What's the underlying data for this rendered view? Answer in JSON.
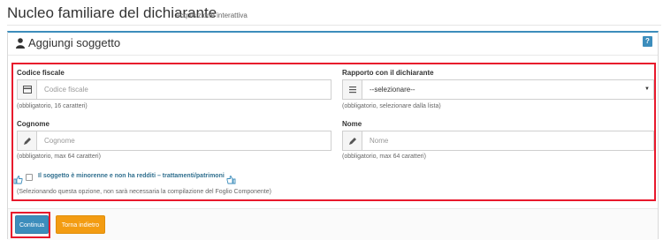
{
  "header": {
    "title": "Nucleo familiare del dichiarante",
    "subtitle": "Acquisizione interattiva"
  },
  "panel": {
    "title": "Aggiungi soggetto",
    "help_label": "?"
  },
  "form": {
    "codice_fiscale": {
      "label": "Codice fiscale",
      "placeholder": "Codice fiscale",
      "hint": "(obbligatorio, 16 caratteri)"
    },
    "rapporto": {
      "label": "Rapporto con il dichiarante",
      "selected": "--selezionare--",
      "hint": "(obbligatorio, selezionare dalla lista)"
    },
    "cognome": {
      "label": "Cognome",
      "placeholder": "Cognome",
      "hint": "(obbligatorio, max 64 caratteri)"
    },
    "nome": {
      "label": "Nome",
      "placeholder": "Nome",
      "hint": "(obbligatorio, max 64 caratteri)"
    },
    "minorenne": {
      "label": "Il soggetto è minorenne e non ha redditi – trattamenti/patrimoni",
      "checked": false,
      "hint": "(Selezionando questa opzione, non sarà necessaria la compilazione del Foglio Componente)"
    }
  },
  "footer": {
    "continue_label": "Continua",
    "back_label": "Torna indietro"
  },
  "colors": {
    "primary": "#3c8dbc",
    "warning": "#f39c12",
    "highlight": "#e8192c"
  },
  "icons": {
    "panel": "user-icon",
    "codice_fiscale": "id-card-icon",
    "rapporto": "list-icon",
    "cognome": "pencil-icon",
    "nome": "pencil-icon",
    "check_left": "thumbs-up-icon",
    "check_right": "thumbs-up-icon"
  }
}
